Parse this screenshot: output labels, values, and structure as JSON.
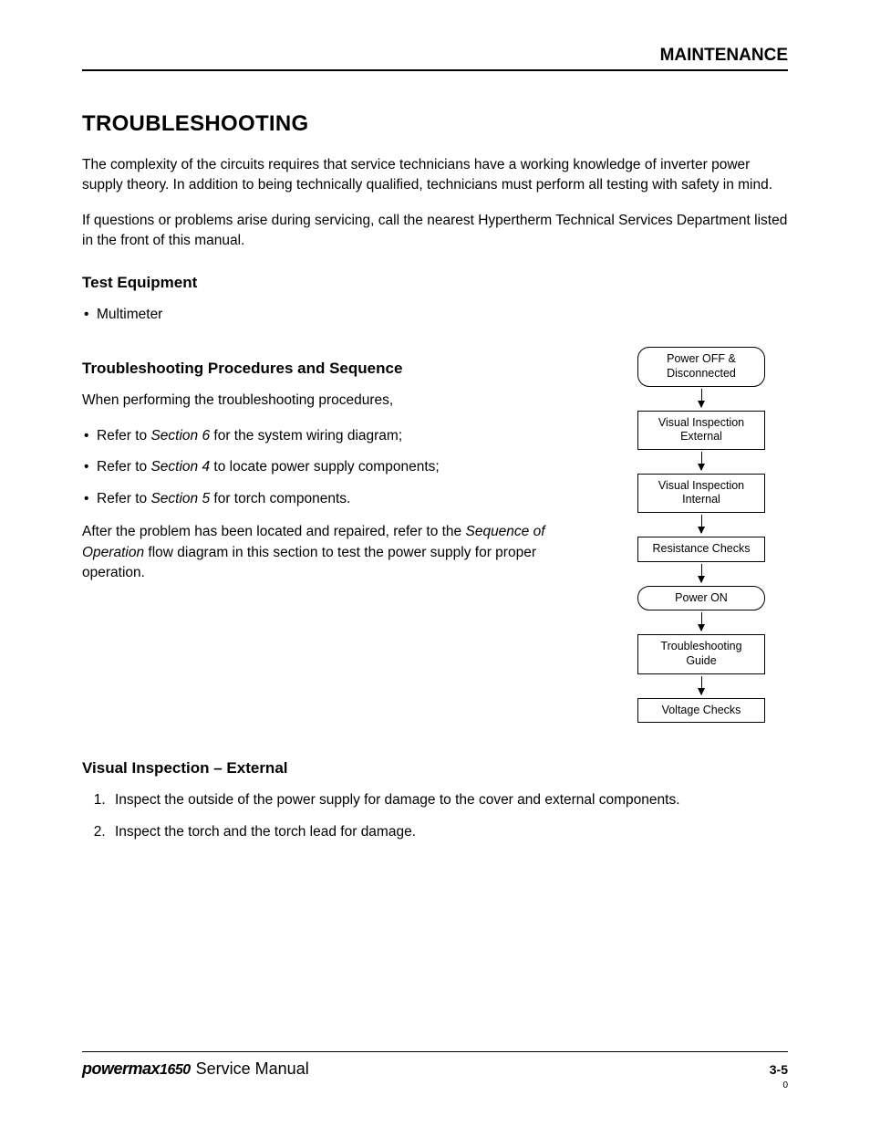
{
  "header": {
    "section": "MAINTENANCE"
  },
  "title": "TROUBLESHOOTING",
  "intro1": "The complexity of the circuits requires that service technicians have a working knowledge of inverter power supply theory.  In addition to being technically qualified, technicians must perform all testing with safety in mind.",
  "intro2": "If questions or problems arise during servicing, call the nearest Hypertherm Technical Services Department listed in the front of this manual.",
  "test_equipment": {
    "heading": "Test Equipment",
    "items": [
      "Multimeter"
    ]
  },
  "procedures": {
    "heading": "Troubleshooting Procedures and Sequence",
    "lead": "When performing the troubleshooting procedures,",
    "bullets": [
      {
        "pre": "Refer to ",
        "em": "Section 6",
        "post": "  for the system wiring diagram;"
      },
      {
        "pre": "Refer to ",
        "em": "Section 4",
        "post": " to locate power supply components;"
      },
      {
        "pre": "Refer to ",
        "em": "Section 5",
        "post": "  for torch components."
      }
    ],
    "after_pre": "After the problem has been located and repaired, refer to the ",
    "after_em": "Sequence of Operation",
    "after_post": " flow diagram in this section to test the power supply for proper operation."
  },
  "flow": {
    "steps": [
      {
        "label": "Power OFF &\nDisconnected",
        "shape": "pill"
      },
      {
        "label": "Visual Inspection\nExternal",
        "shape": "box"
      },
      {
        "label": "Visual Inspection\nInternal",
        "shape": "box"
      },
      {
        "label": "Resistance Checks",
        "shape": "box"
      },
      {
        "label": "Power ON",
        "shape": "pill"
      },
      {
        "label": "Troubleshooting\nGuide",
        "shape": "box"
      },
      {
        "label": "Voltage Checks",
        "shape": "box"
      }
    ]
  },
  "visual_external": {
    "heading": "Visual Inspection – External",
    "items": [
      "Inspect the outside of the power supply for damage to the cover and external components.",
      "Inspect the torch and the torch lead for damage."
    ]
  },
  "footer": {
    "brand": "powermax",
    "brand_num": "1650",
    "title": "Service Manual",
    "page": "3-5",
    "rev": "0"
  }
}
